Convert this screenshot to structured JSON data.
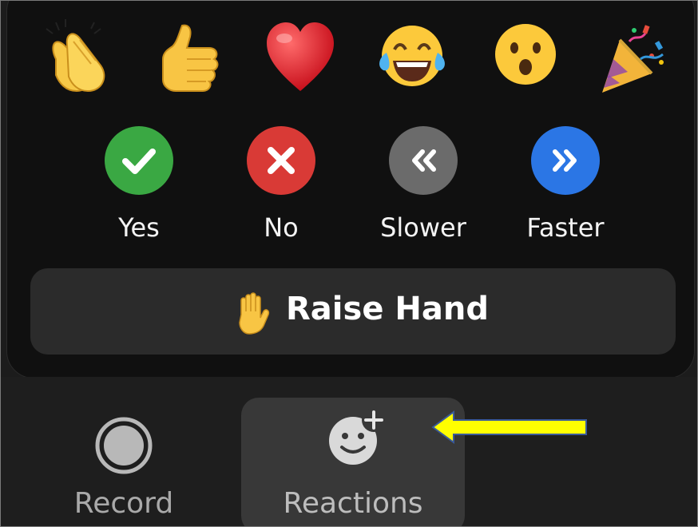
{
  "reactions_popover": {
    "emojis": [
      {
        "icon": "clapping-hands-icon"
      },
      {
        "icon": "thumbs-up-icon"
      },
      {
        "icon": "red-heart-icon"
      },
      {
        "icon": "tears-of-joy-icon"
      },
      {
        "icon": "surprised-face-icon"
      },
      {
        "icon": "party-popper-icon"
      }
    ],
    "feedback": [
      {
        "label": "Yes",
        "icon": "checkmark-icon",
        "color": "#3aa843"
      },
      {
        "label": "No",
        "icon": "x-icon",
        "color": "#d93a36"
      },
      {
        "label": "Slower",
        "icon": "double-chevron-left-icon",
        "color": "#6b6b6b"
      },
      {
        "label": "Faster",
        "icon": "double-chevron-right-icon",
        "color": "#2b76e5"
      }
    ],
    "raise_hand": {
      "label": "Raise Hand",
      "icon": "raised-hand-icon"
    }
  },
  "toolbar": {
    "record": {
      "label": "Record",
      "icon": "record-icon"
    },
    "reactions": {
      "label": "Reactions",
      "icon": "add-reaction-icon"
    }
  },
  "annotation": {
    "icon": "yellow-arrow-icon",
    "color": "#ffff00"
  }
}
